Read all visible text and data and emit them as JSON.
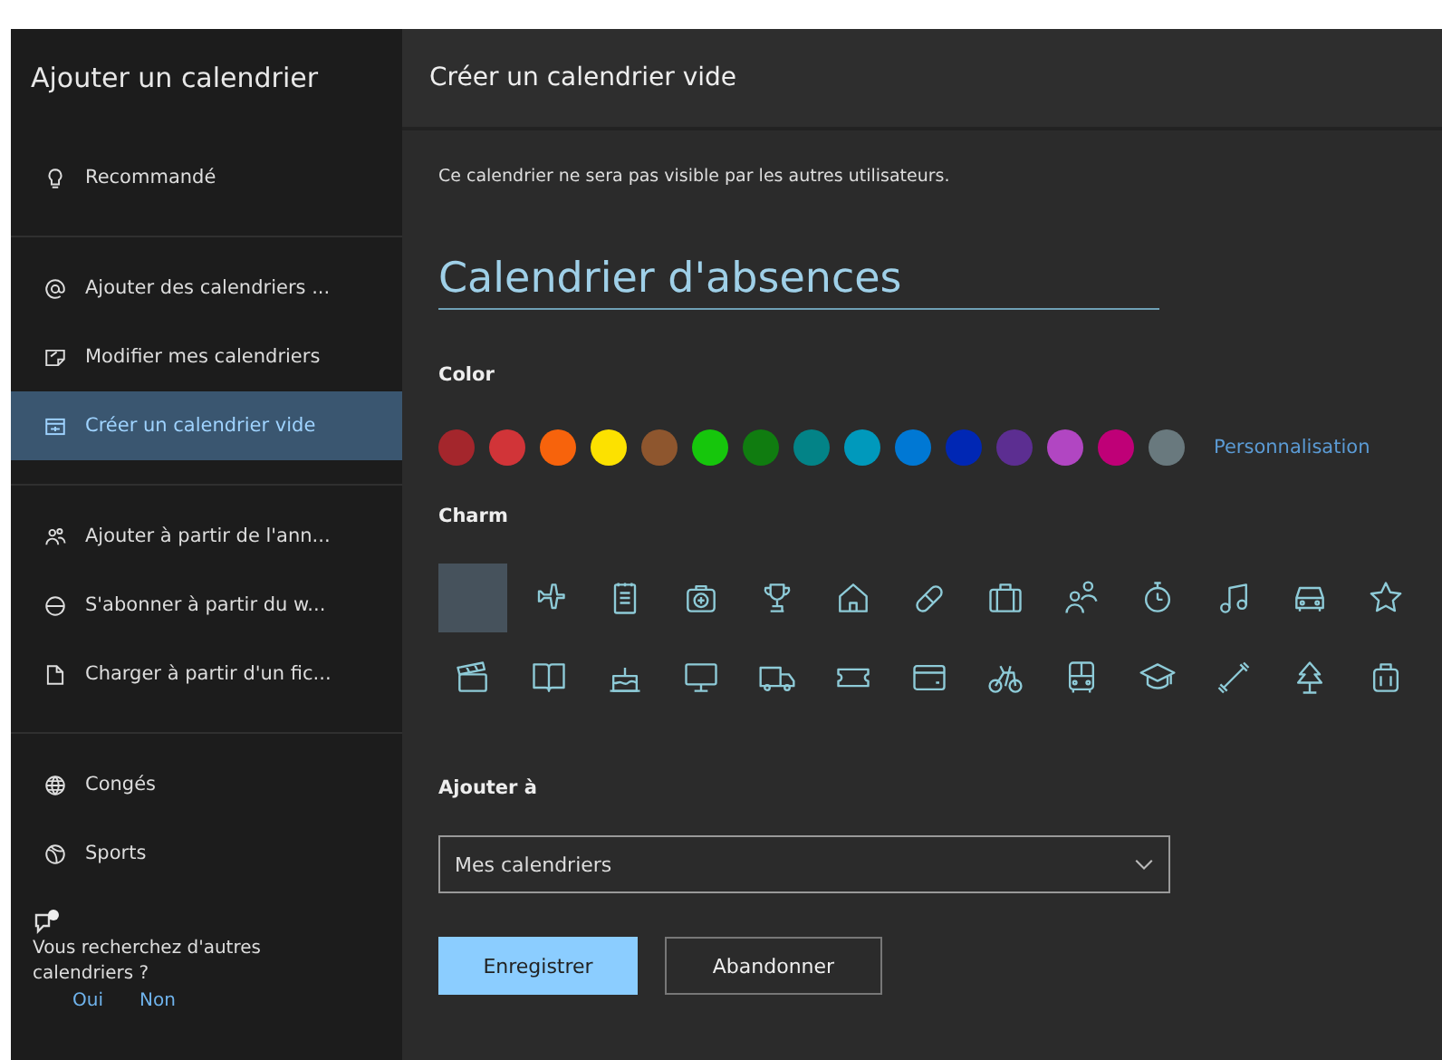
{
  "sidebar": {
    "title": "Ajouter un calendrier",
    "groups": [
      [
        {
          "label": "Recommandé",
          "kind": "bulb",
          "selected": false
        }
      ],
      [
        {
          "label": "Ajouter des calendriers ...",
          "kind": "at",
          "selected": false
        },
        {
          "label": "Modifier mes calendriers",
          "kind": "edit",
          "selected": false
        },
        {
          "label": "Créer un calendrier vide",
          "kind": "calendar",
          "selected": true
        }
      ],
      [
        {
          "label": "Ajouter à partir de l'ann...",
          "kind": "people",
          "selected": false
        },
        {
          "label": "S'abonner à partir du w...",
          "kind": "subscribe",
          "selected": false
        },
        {
          "label": "Charger à partir d'un fic...",
          "kind": "file",
          "selected": false
        }
      ],
      [
        {
          "label": "Congés",
          "kind": "globe",
          "selected": false
        },
        {
          "label": "Sports",
          "kind": "ball",
          "selected": false
        }
      ]
    ],
    "feedback": {
      "question": "Vous recherchez d'autres calendriers ?",
      "links": [
        "Oui",
        "Non"
      ]
    }
  },
  "main": {
    "title": "Créer un calendrier vide",
    "note": "Ce calendrier ne sera pas visible par les autres utilisateurs.",
    "name_field": {
      "value": "Calendrier d'absences"
    },
    "color_label": "Color",
    "colors": [
      {
        "color": "#a4262c"
      },
      {
        "color": "#d13438"
      },
      {
        "color": "#f7630c"
      },
      {
        "color": "#fce100"
      },
      {
        "color": "#8e562e"
      },
      {
        "color": "#16c60c"
      },
      {
        "color": "#107c10"
      },
      {
        "color": "#038387"
      },
      {
        "color": "#0099bc"
      },
      {
        "color": "#0078d4"
      },
      {
        "color": "#0027b4"
      },
      {
        "color": "#5c2e91"
      },
      {
        "color": "#b146c2"
      },
      {
        "color": "#bf0077"
      },
      {
        "color": "#69797e"
      }
    ],
    "custom_link": "Personnalisation",
    "charm_label": "Charm",
    "charms": [
      {
        "kind": "none",
        "selected": true
      },
      {
        "kind": "plane",
        "selected": false
      },
      {
        "kind": "notepad",
        "selected": false
      },
      {
        "kind": "medkit",
        "selected": false
      },
      {
        "kind": "trophy",
        "selected": false
      },
      {
        "kind": "house",
        "selected": false
      },
      {
        "kind": "pill",
        "selected": false
      },
      {
        "kind": "briefcase",
        "selected": false
      },
      {
        "kind": "people",
        "selected": false
      },
      {
        "kind": "stopwatch",
        "selected": false
      },
      {
        "kind": "music",
        "selected": false
      },
      {
        "kind": "car",
        "selected": false
      },
      {
        "kind": "star",
        "selected": false
      },
      {
        "kind": "clapper",
        "selected": false
      },
      {
        "kind": "book",
        "selected": false
      },
      {
        "kind": "cake",
        "selected": false
      },
      {
        "kind": "monitor",
        "selected": false
      },
      {
        "kind": "truck",
        "selected": false
      },
      {
        "kind": "ticket",
        "selected": false
      },
      {
        "kind": "card",
        "selected": false
      },
      {
        "kind": "bike",
        "selected": false
      },
      {
        "kind": "bus",
        "selected": false
      },
      {
        "kind": "cap",
        "selected": false
      },
      {
        "kind": "dumbbell",
        "selected": false
      },
      {
        "kind": "tree",
        "selected": false
      },
      {
        "kind": "luggage",
        "selected": false
      }
    ],
    "add_to_label": "Ajouter à",
    "add_to_select": {
      "value": "Mes calendriers"
    },
    "buttons": [
      {
        "label": "Enregistrer",
        "kind": "primary"
      },
      {
        "label": "Abandonner",
        "kind": "secondary"
      }
    ]
  }
}
